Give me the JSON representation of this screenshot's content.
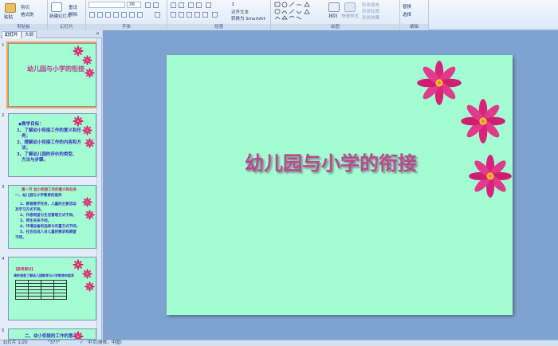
{
  "ribbon": {
    "groups": [
      {
        "label": "剪贴板",
        "buttons": [
          "粘贴",
          "剪切",
          "格式刷"
        ]
      },
      {
        "label": "幻灯片",
        "buttons": [
          "新建幻灯片",
          "重设",
          "删除"
        ]
      },
      {
        "label": "字体",
        "font_size": "36"
      },
      {
        "label": "段落",
        "buttons": [
          "对齐文本",
          "转换为 SmartArt"
        ]
      },
      {
        "label": "绘图",
        "buttons": [
          "排列",
          "快速样式",
          "形状填充",
          "形状轮廓",
          "形状效果"
        ]
      },
      {
        "label": "编辑",
        "buttons": [
          "替换",
          "选择"
        ]
      }
    ]
  },
  "left_pane": {
    "tabs": [
      "幻灯片",
      "大纲"
    ],
    "thumbnails": [
      {
        "num": "1",
        "title": "幼儿园与小学的衔接"
      },
      {
        "num": "2",
        "lines": [
          "◆教学目标：",
          "1、了解幼小衔接工作的意义和任",
          "务；",
          "2、理解幼小衔接工作的内容和方",
          "法；",
          "3、了解幼儿园的评价的类型、",
          "方法与步骤。"
        ]
      },
      {
        "num": "3",
        "lines": [
          "第一节  幼小衔接工作的意义和任务",
          "一、幼儿园与小学教育的差异",
          "1、教育教学任务、儿童的主要活动",
          "及学习方式不同。",
          "2、作息制度与生活管理方式不同。",
          "3、师生关系不同。",
          "4、环境设备的选择与布置方式不同。",
          "5、社会及成人对儿童的要求和期望",
          "不同。"
        ]
      },
      {
        "num": "4",
        "lines": [
          "【思考探讨】",
          "请你调查了解幼儿园教育与小学教育的差异"
        ]
      },
      {
        "num": "5",
        "lines": [
          "二、幼小衔接的工作的意义"
        ]
      }
    ]
  },
  "slide": {
    "title": "幼儿园与小学的衔接"
  },
  "status": {
    "slide_indicator": "幻灯片 1/20",
    "theme": "\"377\"",
    "language": "中文(简体，中国)"
  },
  "colors": {
    "slide_bg": "#a4fcd2",
    "title": "#b94a8d",
    "flower": "#d8237a",
    "workspace": "#7fa3d0"
  }
}
